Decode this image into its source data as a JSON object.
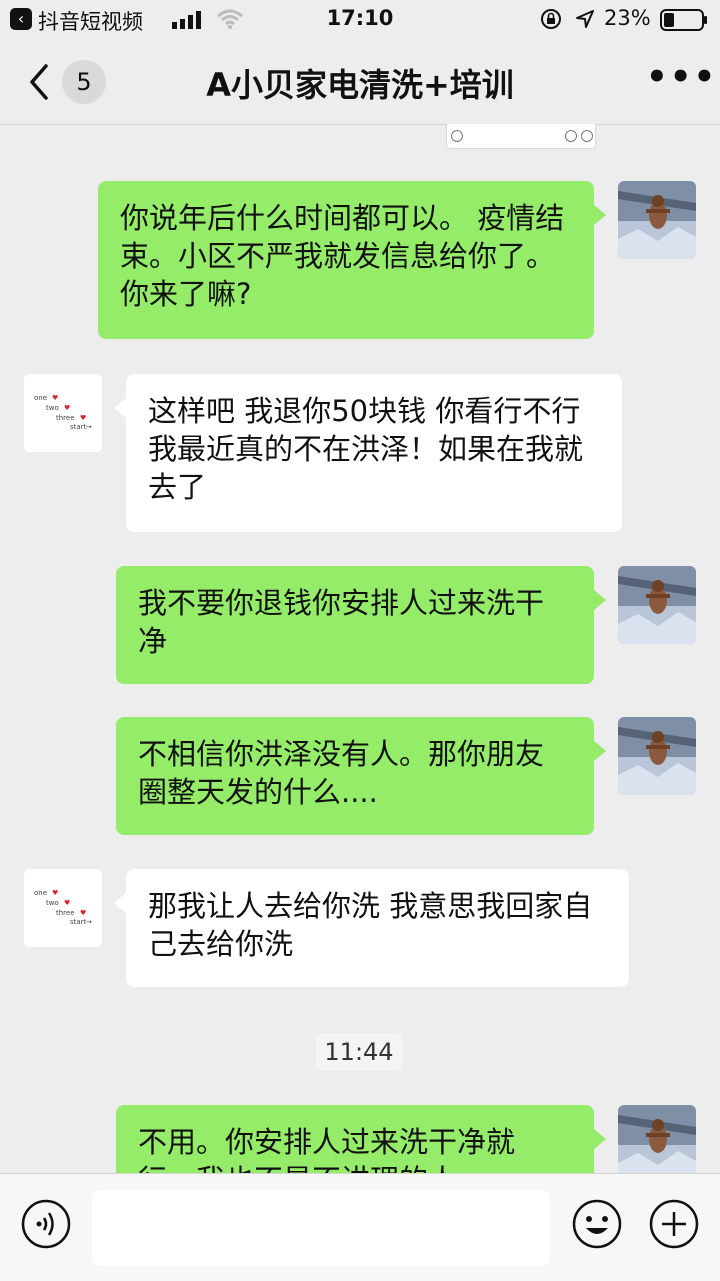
{
  "status_bar": {
    "back_app": "抖音短视频",
    "time": "17:10",
    "battery_percent": "23%"
  },
  "header": {
    "unread_count": "5",
    "title": "A小贝家电清洗+培训",
    "more": "•••"
  },
  "messages": [
    {
      "from": "me",
      "text": "你说年后什么时间都可以。 疫情结束。小区不严我就发信息给你了。你来了嘛?"
    },
    {
      "from": "other",
      "text": "这样吧  我退你50块钱  你看行不行  我最近真的不在洪泽！如果在我就去了"
    },
    {
      "from": "me",
      "text": "我不要你退钱你安排人过来洗干净"
    },
    {
      "from": "me",
      "text": "不相信你洪泽没有人。那你朋友圈整天发的什么...."
    },
    {
      "from": "other",
      "text": "那我让人去给你洗   我意思我回家自己去给你洗"
    },
    {
      "from": "me",
      "text": "不用。你安排人过来洗干净就行。我也不是不讲理的人"
    }
  ],
  "time_divider": "11:44",
  "other_avatar_text": [
    "one",
    "two",
    "three",
    "start"
  ],
  "input_bar": {
    "placeholder": ""
  }
}
